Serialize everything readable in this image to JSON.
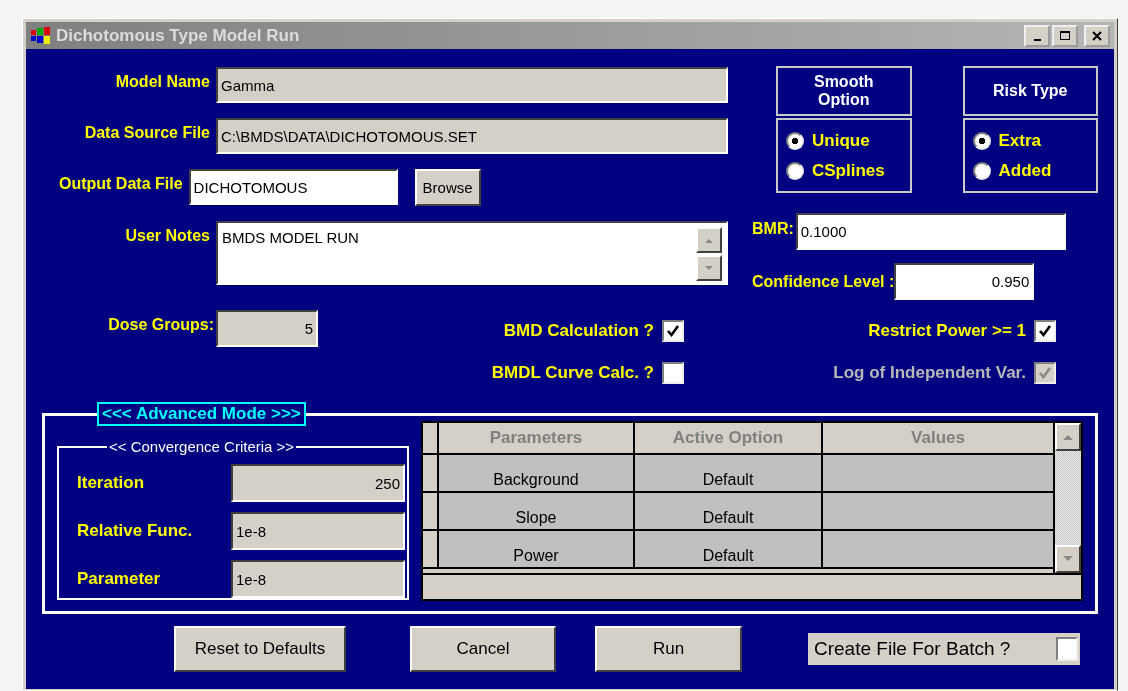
{
  "window": {
    "title": "Dichotomous Type Model Run"
  },
  "file_fields": [
    {
      "kind": "text",
      "label": "Model Name",
      "value": "Gamma",
      "editable": false
    },
    {
      "kind": "text",
      "label": "Data Source File",
      "value": "C:\\BMDS\\DATA\\DICHOTOMOUS.SET",
      "editable": false
    },
    {
      "kind": "browse",
      "label": "Output Data File",
      "value": "DICHOTOMOUS",
      "editable": true,
      "button": "Browse"
    },
    {
      "kind": "notes",
      "label": "User Notes",
      "value": "BMDS MODEL RUN",
      "editable": true
    }
  ],
  "option_groups": [
    {
      "title": "Smooth Option",
      "options": [
        {
          "label": "Unique",
          "selected": true
        },
        {
          "label": "CSplines",
          "selected": false
        }
      ]
    },
    {
      "title": "Risk Type",
      "options": [
        {
          "label": "Extra",
          "selected": true
        },
        {
          "label": "Added",
          "selected": false
        }
      ]
    }
  ],
  "bmr": {
    "label": "BMR:",
    "value": "0.1000"
  },
  "confidence_level": {
    "label": "Confidence Level :",
    "value": "0.950"
  },
  "dose_groups": {
    "label": "Dose Groups:",
    "value": "5"
  },
  "checkboxes": [
    {
      "label": "BMD Calculation ?",
      "checked": true,
      "disabled": false
    },
    {
      "label": "Restrict Power >= 1",
      "checked": true,
      "disabled": false
    },
    {
      "label": "BMDL Curve Calc. ?",
      "checked": false,
      "disabled": false
    },
    {
      "label": "Log of Independent Var.",
      "checked": true,
      "disabled": true
    }
  ],
  "advanced": {
    "title": "<<< Advanced Mode >>>",
    "convergence": {
      "title": "<< Convergence Criteria >>",
      "rows": [
        {
          "kind": "number",
          "label": "Iteration",
          "value": "250"
        },
        {
          "kind": "text",
          "label": "Relative Func.",
          "value": "1e-8"
        },
        {
          "kind": "text",
          "label": "Parameter",
          "value": "1e-8"
        }
      ]
    },
    "table": {
      "columns": [
        "Parameters",
        "Active Option",
        "Values"
      ],
      "rows": [
        {
          "parameter": "Background",
          "option": "Default"
        },
        {
          "parameter": "Slope",
          "option": "Default"
        },
        {
          "parameter": "Power",
          "option": "Default"
        }
      ]
    }
  },
  "buttons": [
    "Reset to Defaults",
    "Cancel",
    "Run"
  ],
  "batch": {
    "label": "Create File For Batch ?",
    "checked": false
  }
}
